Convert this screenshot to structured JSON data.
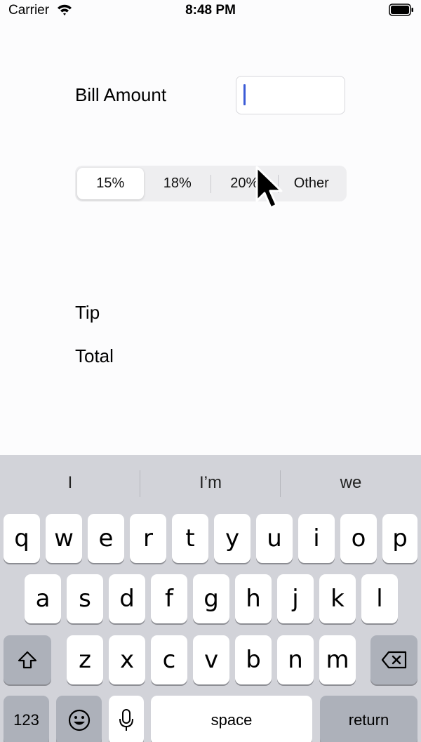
{
  "status_bar": {
    "carrier": "Carrier",
    "time": "8:48 PM",
    "wifi_icon": "wifi-icon",
    "battery_icon": "battery-icon"
  },
  "form": {
    "bill_label": "Bill Amount",
    "bill_value": "",
    "segments": [
      "15%",
      "18%",
      "20%",
      "Other"
    ],
    "selected_segment": "15%",
    "tip_label": "Tip",
    "total_label": "Total"
  },
  "keyboard": {
    "suggestions": [
      "I",
      "I’m",
      "we"
    ],
    "row1": [
      "q",
      "w",
      "e",
      "r",
      "t",
      "y",
      "u",
      "i",
      "o",
      "p"
    ],
    "row2": [
      "a",
      "s",
      "d",
      "f",
      "g",
      "h",
      "j",
      "k",
      "l"
    ],
    "row3": [
      "z",
      "x",
      "c",
      "v",
      "b",
      "n",
      "m"
    ],
    "numbers_label": "123",
    "space_label": "space",
    "return_label": "return",
    "shift_icon": "shift-icon",
    "delete_icon": "delete-icon",
    "emoji_icon": "emoji-icon",
    "mic_icon": "microphone-icon"
  },
  "colors": {
    "caret": "#3b5bd6",
    "keyboard_bg": "#d2d3d9",
    "dark_key": "#adb1ba"
  }
}
